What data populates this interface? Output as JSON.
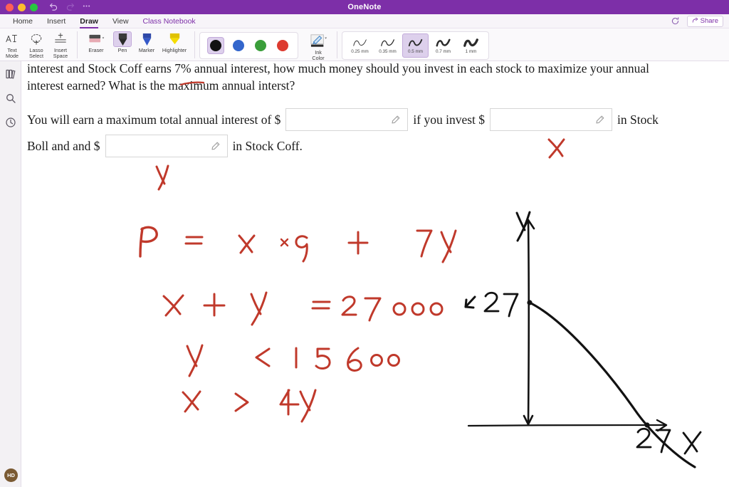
{
  "window": {
    "title": "OneNote",
    "traffic_lights": [
      "close",
      "minimize",
      "maximize"
    ],
    "undo_icon": "undo-icon",
    "redo_icon": "redo-icon",
    "more_icon": "ellipsis-icon",
    "titlebar_color": "#7d2fa8"
  },
  "menubar": {
    "tabs": [
      {
        "label": "Home",
        "active": false
      },
      {
        "label": "Insert",
        "active": false
      },
      {
        "label": "Draw",
        "active": true
      },
      {
        "label": "View",
        "active": false
      },
      {
        "label": "Class Notebook",
        "active": false,
        "accent": true
      }
    ],
    "sync_icon": "sync-icon",
    "share_label": "Share",
    "share_icon": "share-icon",
    "accent_color": "#7d2fa8"
  },
  "ribbon": {
    "tools": [
      {
        "label_top": "Text",
        "label_bottom": "Mode",
        "icon": "text-mode-icon"
      },
      {
        "label_top": "Lasso",
        "label_bottom": "Select",
        "icon": "lasso-select-icon"
      },
      {
        "label_top": "Insert",
        "label_bottom": "Space",
        "icon": "insert-space-icon"
      }
    ],
    "pens": [
      {
        "label": "Eraser",
        "icon": "eraser-icon",
        "selected": false,
        "has_dropdown": true
      },
      {
        "label": "Pen",
        "icon": "pen-icon",
        "selected": true,
        "has_dropdown": false
      },
      {
        "label": "Marker",
        "icon": "marker-icon",
        "selected": false,
        "has_dropdown": false
      },
      {
        "label": "Highlighter",
        "icon": "highlighter-icon",
        "selected": false,
        "has_dropdown": false
      }
    ],
    "colors": [
      {
        "name": "black",
        "hex": "#121212",
        "selected": true
      },
      {
        "name": "blue",
        "hex": "#3366cc",
        "selected": false
      },
      {
        "name": "green",
        "hex": "#3a9e3a",
        "selected": false
      },
      {
        "name": "red",
        "hex": "#dd3b30",
        "selected": false
      }
    ],
    "ink_color": {
      "label_top": "Ink",
      "label_bottom": "Color",
      "icon": "ink-color-icon"
    },
    "thickness": [
      {
        "label": "0.25 mm",
        "stroke": 1.0,
        "selected": false
      },
      {
        "label": "0.35 mm",
        "stroke": 1.4,
        "selected": false
      },
      {
        "label": "0.5 mm",
        "stroke": 2.0,
        "selected": true
      },
      {
        "label": "0.7 mm",
        "stroke": 2.7,
        "selected": false
      },
      {
        "label": "1 mm",
        "stroke": 3.6,
        "selected": false
      }
    ]
  },
  "rail": {
    "items": [
      {
        "name": "notebooks",
        "icon": "notebooks-icon"
      },
      {
        "name": "search",
        "icon": "search-icon"
      },
      {
        "name": "recent",
        "icon": "clock-icon"
      }
    ],
    "avatar_initials": "HD"
  },
  "page": {
    "paragraph_line_1": "interest and Stock Coff earns 7% annual interest, how much money should you invest in each stock to maximize your annual",
    "paragraph_line_2": "interest earned? What is the maximum annual interst?",
    "fill_row_1": {
      "prefix": "You will earn a maximum total annual interest of $",
      "middle": "if you invest $",
      "suffix": "in Stock"
    },
    "fill_row_2": {
      "prefix": "Boll and and $",
      "suffix": "in Stock Coff."
    },
    "input_placeholder": "",
    "input_value": "",
    "pencil_icon": "pencil-icon"
  },
  "ink": {
    "color_red": "#c0392b",
    "color_black": "#121212",
    "annotations": [
      {
        "name": "underline-maximum",
        "text": "",
        "color": "#c0392b"
      },
      {
        "name": "handwritten-x-label",
        "text": "x",
        "color": "#c0392b"
      },
      {
        "name": "handwritten-y-label",
        "text": "y",
        "color": "#c0392b"
      },
      {
        "name": "equation-profit",
        "text": "P = x x 9 + 7y",
        "color": "#c0392b"
      },
      {
        "name": "equation-constraint-sum",
        "text": "x + y = 27000",
        "color": "#c0392b"
      },
      {
        "name": "equation-constraint-y",
        "text": "y < 15600",
        "color": "#c0392b"
      },
      {
        "name": "equation-constraint-x",
        "text": "x > 4y",
        "color": "#c0392b"
      },
      {
        "name": "graph-y-axis-label",
        "text": "y",
        "color": "#121212"
      },
      {
        "name": "graph-x-axis-label",
        "text": "x",
        "color": "#121212"
      },
      {
        "name": "graph-y-intercept-label",
        "text": "27",
        "color": "#121212"
      },
      {
        "name": "graph-x-intercept-label",
        "text": "27",
        "color": "#121212"
      }
    ]
  }
}
